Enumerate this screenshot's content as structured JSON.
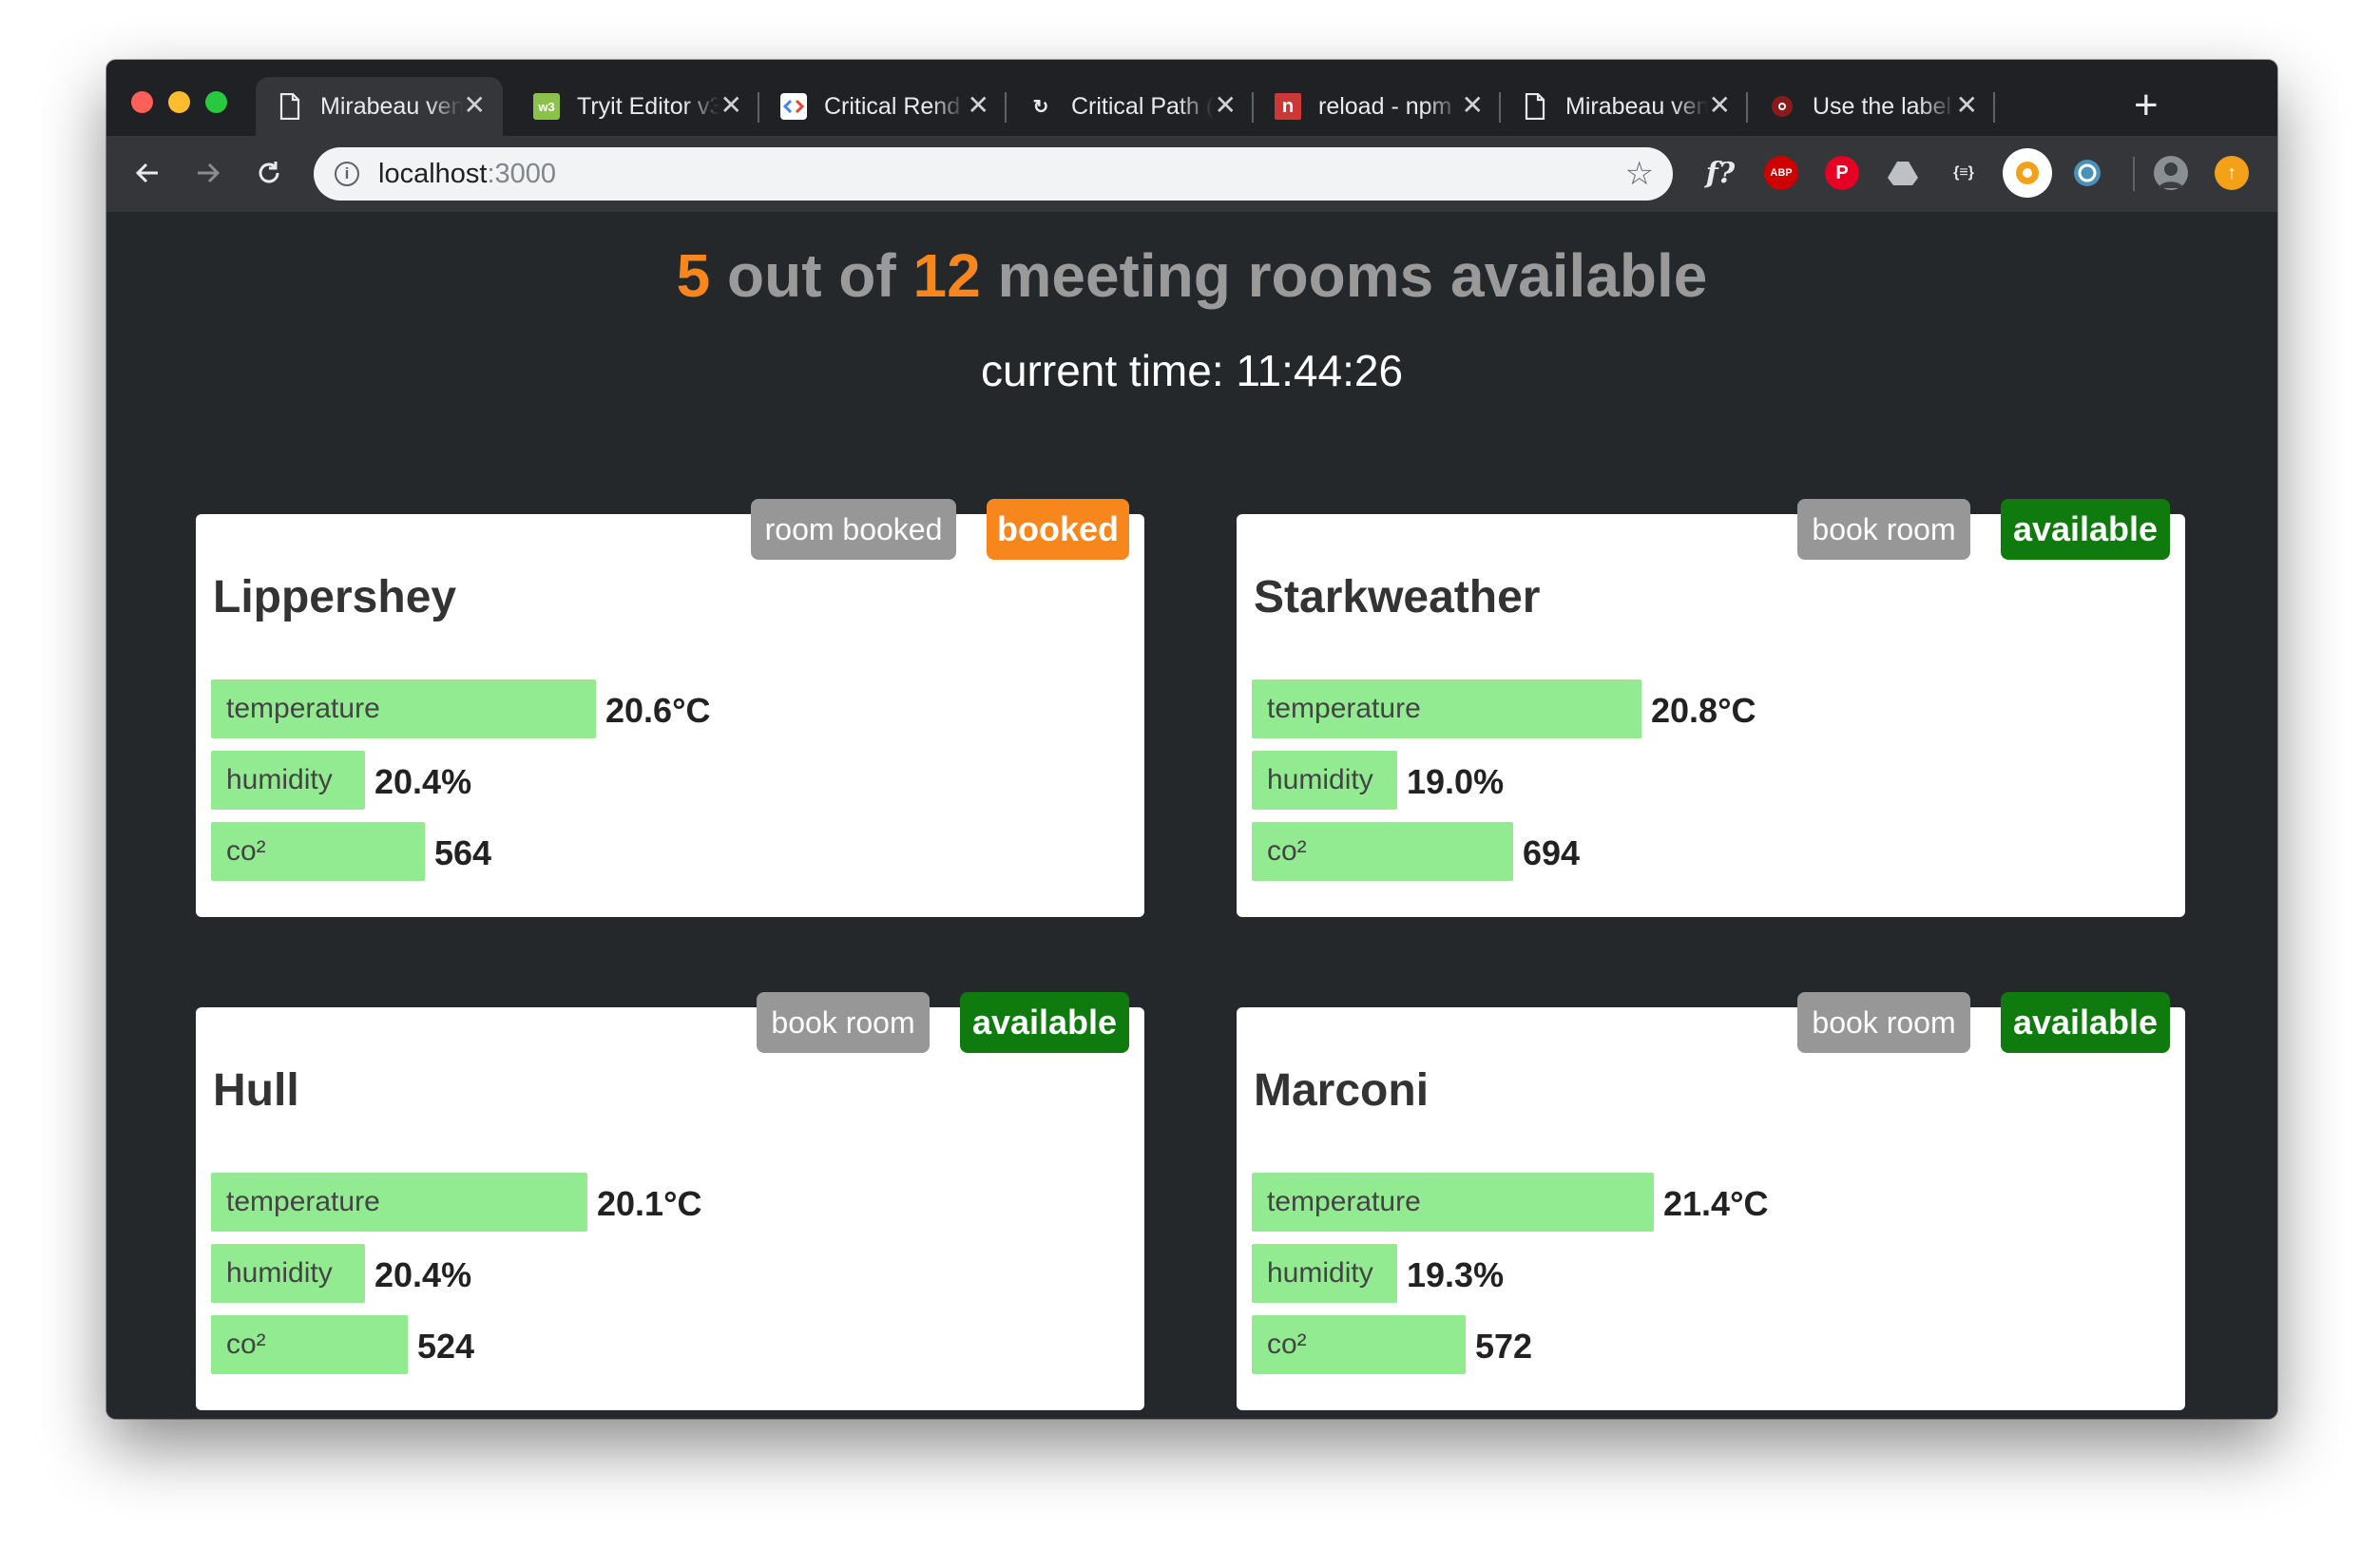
{
  "browser": {
    "tabs": [
      {
        "label": "Mirabeau ven",
        "icon": "document-icon",
        "active": true
      },
      {
        "label": "Tryit Editor v3",
        "icon": "w3schools-icon",
        "active": false
      },
      {
        "label": "Critical Rend",
        "icon": "google-developers-icon",
        "active": false
      },
      {
        "label": "Critical Path (",
        "icon": "arrow-icon",
        "active": false
      },
      {
        "label": "reload - npm",
        "icon": "npm-icon",
        "active": false
      },
      {
        "label": "Mirabeau ven",
        "icon": "document-icon",
        "active": false
      },
      {
        "label": "Use the label",
        "icon": "eye-icon",
        "active": false
      }
    ],
    "address": {
      "host": "localhost",
      "port": ":3000"
    },
    "extensions": [
      "f?",
      "ABP",
      "pinterest-icon",
      "drive-icon",
      "{≡}",
      "gear-extension-icon",
      "circle-extension-icon",
      "avatar-icon",
      "update-icon"
    ]
  },
  "page": {
    "available_count": "5",
    "out_of_text": " out of ",
    "total_count": "12",
    "suffix_text": " meeting rooms available",
    "clock": "current time: 11:44:26"
  },
  "colors": {
    "booked": "#f7861c",
    "available": "#0f7a0d",
    "bar": "#92eb91",
    "button": "#979797"
  },
  "rooms": [
    {
      "name": "Lippershey",
      "action": "room booked",
      "status": "booked",
      "status_color": "#f7861c",
      "temperature": {
        "label": "temperature",
        "value": "20.6°C",
        "fill": 0.45
      },
      "humidity": {
        "label": "humidity",
        "value": "20.4%",
        "fill": 0.18
      },
      "co2": {
        "label": "co²",
        "value": "564",
        "fill": 0.25
      }
    },
    {
      "name": "Starkweather",
      "action": "book room",
      "status": "available",
      "status_color": "#0f7a0d",
      "temperature": {
        "label": "temperature",
        "value": "20.8°C",
        "fill": 0.455
      },
      "humidity": {
        "label": "humidity",
        "value": "19.0%",
        "fill": 0.17
      },
      "co2": {
        "label": "co²",
        "value": "694",
        "fill": 0.305
      }
    },
    {
      "name": "Hull",
      "action": "book room",
      "status": "available",
      "status_color": "#0f7a0d",
      "temperature": {
        "label": "temperature",
        "value": "20.1°C",
        "fill": 0.44
      },
      "humidity": {
        "label": "humidity",
        "value": "20.4%",
        "fill": 0.18
      },
      "co2": {
        "label": "co²",
        "value": "524",
        "fill": 0.23
      }
    },
    {
      "name": "Marconi",
      "action": "book room",
      "status": "available",
      "status_color": "#0f7a0d",
      "temperature": {
        "label": "temperature",
        "value": "21.4°C",
        "fill": 0.47
      },
      "humidity": {
        "label": "humidity",
        "value": "19.3%",
        "fill": 0.17
      },
      "co2": {
        "label": "co²",
        "value": "572",
        "fill": 0.25
      }
    }
  ]
}
